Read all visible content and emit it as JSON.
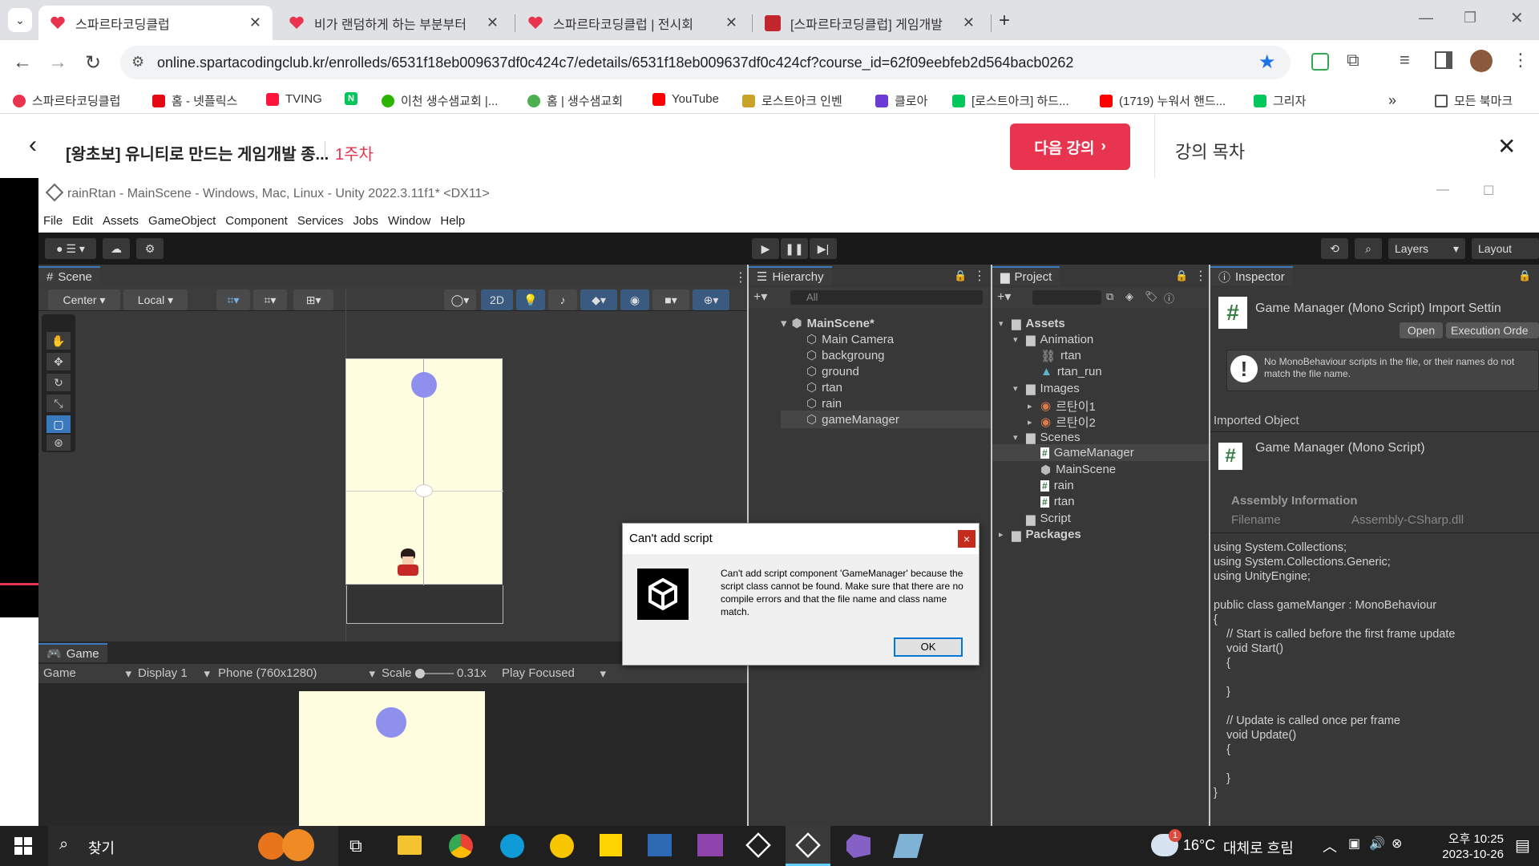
{
  "browser": {
    "tabs": [
      {
        "title": "스파르타코딩클럽",
        "active": true
      },
      {
        "title": "비가 랜덤하게 하는 부분부터",
        "active": false
      },
      {
        "title": "스파르타코딩클럽 | 전시회",
        "active": false
      },
      {
        "title": "[스파르타코딩클럽] 게임개발",
        "active": false
      }
    ],
    "url": "online.spartacodingclub.kr/enrolleds/6531f18eb009637df0c424c7/edetails/6531f18eb009637df0c424cf?course_id=62f09eebfeb2d564bacb0262",
    "bookmarks": [
      "스파르타코딩클럽",
      "홈 - 넷플릭스",
      "TVING",
      "N",
      "이천 생수샘교회 |...",
      "홈 | 생수샘교회",
      "YouTube",
      "로스트아크 인벤",
      "클로아",
      "[로스트아크] 하드...",
      "(1719) 누워서 핸드...",
      "그리자"
    ],
    "all_bookmarks": "모든 북마크",
    "more": "»"
  },
  "course_header": {
    "title": "[왕초보] 유니티로 만드는 게임개발 종...",
    "week": "1주차",
    "next_button": "다음 강의",
    "toc": "강의 목차"
  },
  "unity": {
    "title": "rainRtan - MainScene - Windows, Mac, Linux - Unity 2022.3.11f1* <DX11>",
    "menu": [
      "File",
      "Edit",
      "Assets",
      "GameObject",
      "Component",
      "Services",
      "Jobs",
      "Window",
      "Help"
    ],
    "toolbar_right": {
      "layers": "Layers",
      "layout": "Layout"
    },
    "scene": {
      "tab": "Scene",
      "pivot": "Center",
      "space": "Local",
      "mode2d": "2D"
    },
    "game": {
      "tab": "Game",
      "view": "Game",
      "display": "Display 1",
      "resolution": "Phone (760x1280)",
      "scale_label": "Scale",
      "scale_value": "0.31x",
      "play_mode": "Play Focused"
    },
    "hierarchy": {
      "tab": "Hierarchy",
      "search": "All",
      "scene": "MainScene*",
      "items": [
        "Main Camera",
        "backgroung",
        "ground",
        "rtan",
        "rain",
        "gameManager"
      ]
    },
    "project": {
      "tab": "Project",
      "tree": [
        {
          "label": "Assets",
          "level": 0,
          "icon": "folder-icon",
          "bold": true
        },
        {
          "label": "Animation",
          "level": 1,
          "icon": "folder-icon"
        },
        {
          "label": "rtan",
          "level": 2,
          "icon": "animator-icon"
        },
        {
          "label": "rtan_run",
          "level": 2,
          "icon": "animation-clip-icon"
        },
        {
          "label": "Images",
          "level": 1,
          "icon": "folder-icon"
        },
        {
          "label": "르탄이1",
          "level": 2,
          "icon": "sprite-icon"
        },
        {
          "label": "르탄이2",
          "level": 2,
          "icon": "sprite-icon"
        },
        {
          "label": "Scenes",
          "level": 1,
          "icon": "folder-icon"
        },
        {
          "label": "GameManager",
          "level": 2,
          "icon": "script-icon",
          "selected": true
        },
        {
          "label": "MainScene",
          "level": 2,
          "icon": "unity-scene-icon"
        },
        {
          "label": "rain",
          "level": 2,
          "icon": "script-icon"
        },
        {
          "label": "rtan",
          "level": 2,
          "icon": "script-icon"
        },
        {
          "label": "Script",
          "level": 1,
          "icon": "folder-icon"
        },
        {
          "label": "Packages",
          "level": 0,
          "icon": "folder-icon",
          "bold": true
        }
      ]
    },
    "inspector": {
      "tab": "Inspector",
      "header": "Game Manager (Mono Script) Import Settin",
      "open": "Open",
      "execution_order": "Execution Orde",
      "warning": "No MonoBehaviour scripts in the file, or their names do not match the file name.",
      "imported_object": "Imported Object",
      "object_name": "Game Manager (Mono Script)",
      "assembly_info": "Assembly Information",
      "filename_label": "Filename",
      "filename_value": "Assembly-CSharp.dll",
      "code": [
        "using System.Collections;",
        "using System.Collections.Generic;",
        "using UnityEngine;",
        "",
        "public class gameManger : MonoBehaviour",
        "{",
        "    // Start is called before the first frame update",
        "    void Start()",
        "    {",
        "",
        "    }",
        "",
        "    // Update is called once per frame",
        "    void Update()",
        "    {",
        "",
        "    }",
        "}"
      ]
    },
    "dialog": {
      "title": "Can't add script",
      "close": "×",
      "message": "Can't add script component 'GameManager' because the script class cannot be found. Make sure that there are no compile errors and that the file name and class name match.",
      "ok": "OK"
    }
  },
  "taskbar": {
    "search": "찾기",
    "weather_temp": "16°C",
    "weather_desc": "대체로 흐림",
    "time": "오후 10:25",
    "date": "2023-10-26",
    "weather_badge": "1"
  },
  "colors": {
    "accent_red": "#e8344e",
    "unity_dark": "#282828",
    "selection_blue": "#3a79bb"
  }
}
